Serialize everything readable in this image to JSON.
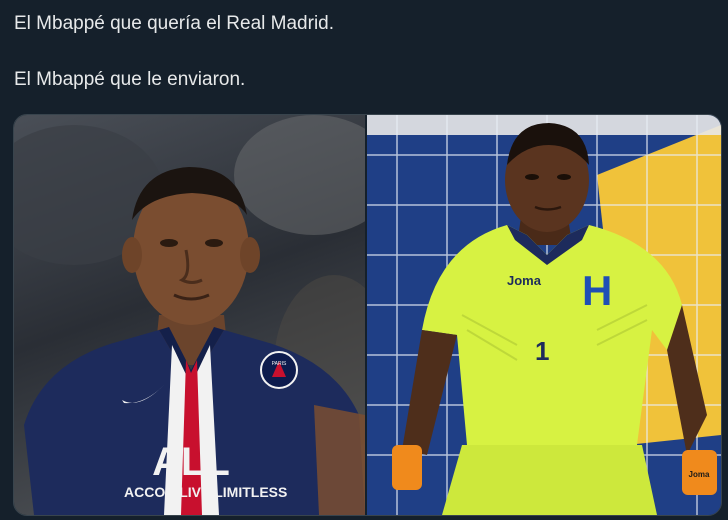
{
  "post": {
    "line1": "El Mbappé que quería el Real Madrid.",
    "line2": "El Mbappé que le enviaron."
  },
  "media": {
    "left_image": {
      "icon": "player-photo-psg",
      "jersey_sponsor": "ACCOR LIVE LIMITLESS",
      "jersey_logo": "ALL",
      "crest_text": "PARIS",
      "colors": {
        "jersey": "#1d2b5c",
        "stripe": "#c8102e",
        "white": "#f2f2f2"
      }
    },
    "right_image": {
      "icon": "player-photo-honduras",
      "jersey_brand": "Joma",
      "jersey_number": "1",
      "crest_letter": "H",
      "glove_text": "Joma",
      "colors": {
        "jersey": "#d7f242",
        "background": "#1f3f86",
        "accent": "#f0c23a"
      }
    }
  }
}
